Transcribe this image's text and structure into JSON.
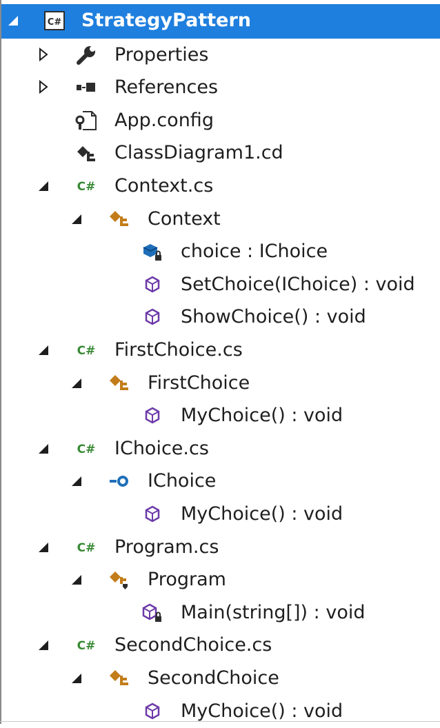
{
  "tree": [
    {
      "label": "StrategyPattern",
      "depth": 0,
      "icon": "csharp-project-icon",
      "expander": "expanded",
      "selected": true
    },
    {
      "label": "Properties",
      "depth": 1,
      "icon": "wrench-icon",
      "expander": "collapsed"
    },
    {
      "label": "References",
      "depth": 1,
      "icon": "references-icon",
      "expander": "collapsed"
    },
    {
      "label": "App.config",
      "depth": 1,
      "icon": "config-file-icon",
      "expander": "none"
    },
    {
      "label": "ClassDiagram1.cd",
      "depth": 1,
      "icon": "class-diagram-icon",
      "expander": "none"
    },
    {
      "label": "Context.cs",
      "depth": 1,
      "icon": "csharp-file-icon",
      "expander": "expanded"
    },
    {
      "label": "Context",
      "depth": 2,
      "icon": "class-icon",
      "expander": "expanded"
    },
    {
      "label": "choice : IChoice",
      "depth": 3,
      "icon": "private-field-icon",
      "expander": "none"
    },
    {
      "label": "SetChoice(IChoice) : void",
      "depth": 3,
      "icon": "method-icon",
      "expander": "none"
    },
    {
      "label": "ShowChoice() : void",
      "depth": 3,
      "icon": "method-icon",
      "expander": "none"
    },
    {
      "label": "FirstChoice.cs",
      "depth": 1,
      "icon": "csharp-file-icon",
      "expander": "expanded"
    },
    {
      "label": "FirstChoice",
      "depth": 2,
      "icon": "class-icon",
      "expander": "expanded"
    },
    {
      "label": "MyChoice() : void",
      "depth": 3,
      "icon": "method-icon",
      "expander": "none"
    },
    {
      "label": "IChoice.cs",
      "depth": 1,
      "icon": "csharp-file-icon",
      "expander": "expanded"
    },
    {
      "label": "IChoice",
      "depth": 2,
      "icon": "interface-icon",
      "expander": "expanded"
    },
    {
      "label": "MyChoice() : void",
      "depth": 3,
      "icon": "method-icon",
      "expander": "none"
    },
    {
      "label": "Program.cs",
      "depth": 1,
      "icon": "csharp-file-icon",
      "expander": "expanded"
    },
    {
      "label": "Program",
      "depth": 2,
      "icon": "internal-class-icon",
      "expander": "expanded"
    },
    {
      "label": "Main(string[]) : void",
      "depth": 3,
      "icon": "private-method-icon",
      "expander": "none"
    },
    {
      "label": "SecondChoice.cs",
      "depth": 1,
      "icon": "csharp-file-icon",
      "expander": "expanded"
    },
    {
      "label": "SecondChoice",
      "depth": 2,
      "icon": "class-icon",
      "expander": "expanded"
    },
    {
      "label": "MyChoice() : void",
      "depth": 3,
      "icon": "method-icon",
      "expander": "none"
    }
  ],
  "colors": {
    "selection": "#1f7fde",
    "csharp_green": "#388a34",
    "class_orange": "#c27d1a",
    "method_purple": "#6c3aa8",
    "field_blue": "#1f6fb8"
  }
}
